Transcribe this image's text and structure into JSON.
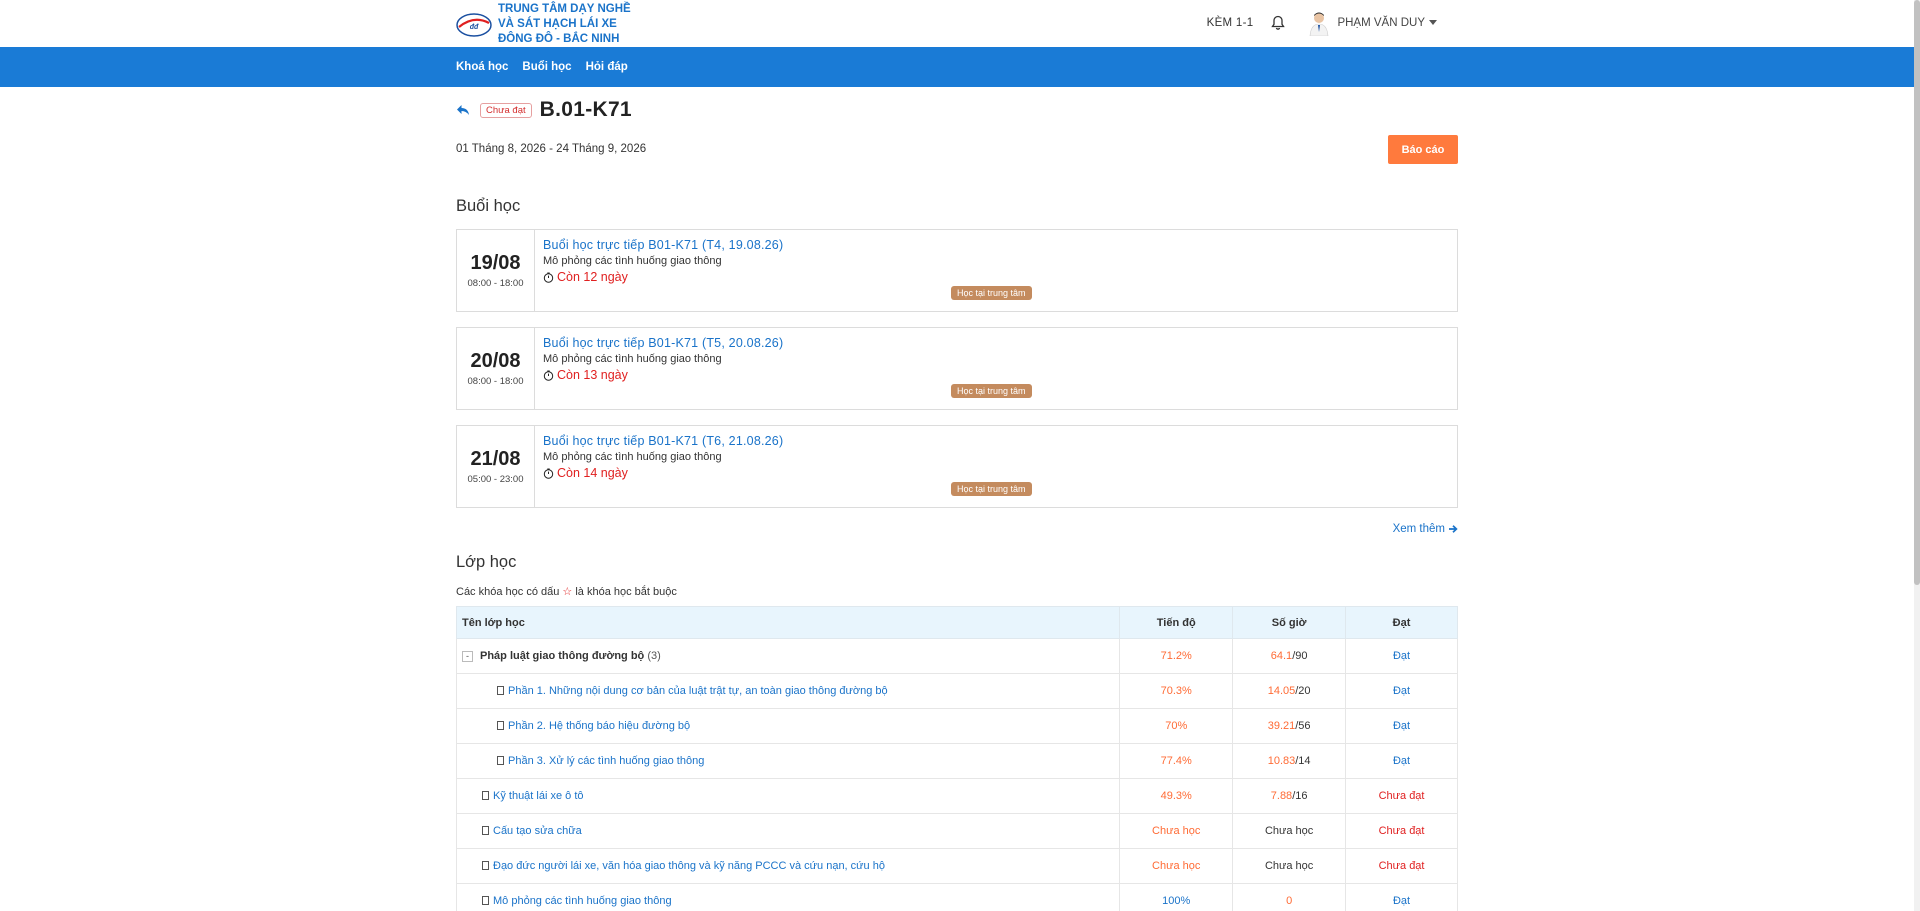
{
  "brand": {
    "name": "TRUNG TÂM DẠY NGHỀ VÀ SÁT HẠCH LÁI XE ĐÔNG ĐÔ - BẮC NINH",
    "logo_icon": "dong-do-logo"
  },
  "topbar": {
    "kem_label": "KÈM 1-1",
    "user_name": "PHẠM VĂN DUY"
  },
  "nav": {
    "items": [
      "Khoá học",
      "Buổi học",
      "Hỏi đáp"
    ]
  },
  "course": {
    "status": "Chưa đạt",
    "code": "B.01-K71",
    "date_range": "01 Tháng 8, 2026 - 24 Tháng 9, 2026",
    "report_label": "Báo cáo"
  },
  "sessions_section": {
    "title": "Buổi học",
    "items": [
      {
        "day": "19/08",
        "time": "08:00 - 18:00",
        "title": "Buổi học trực tiếp B01-K71 (T4, 19.08.26)",
        "subtitle": "Mô phỏng các tình huống giao thông",
        "remaining": "Còn 12 ngày",
        "tag": "Học tại trung tâm"
      },
      {
        "day": "20/08",
        "time": "08:00 - 18:00",
        "title": "Buổi học trực tiếp B01-K71 (T5, 20.08.26)",
        "subtitle": "Mô phỏng các tình huống giao thông",
        "remaining": "Còn 13 ngày",
        "tag": "Học tại trung tâm"
      },
      {
        "day": "21/08",
        "time": "05:00 - 23:00",
        "title": "Buổi học trực tiếp B01-K71 (T6, 21.08.26)",
        "subtitle": "Mô phỏng các tình huống giao thông",
        "remaining": "Còn 14 ngày",
        "tag": "Học tại trung tâm"
      }
    ],
    "see_more": "Xem thêm"
  },
  "classes_section": {
    "title": "Lớp học",
    "note_before": "Các khóa học có dấu",
    "note_star": "☆",
    "note_after": "là khóa học bắt buộc",
    "headers": {
      "name": "Tên lớp học",
      "progress": "Tiến độ",
      "hours": "Số giờ",
      "pass": "Đạt"
    },
    "group": {
      "toggle": "-",
      "name": "Pháp luật giao thông đường bộ",
      "count": "(3)",
      "progress": "71.2%",
      "hours_done": "64.1",
      "hours_total": "/90",
      "pass": "Đạt"
    },
    "rows": [
      {
        "name": "Phần 1. Những nội dung cơ bản của luật trật tự, an toàn giao thông đường bộ",
        "progress": "70.3%",
        "hours_done": "14.05",
        "hours_total": "/20",
        "pass": "Đạt"
      },
      {
        "name": "Phần 2. Hệ thống báo hiệu đường bộ",
        "progress": "70%",
        "hours_done": "39.21",
        "hours_total": "/56",
        "pass": "Đạt"
      },
      {
        "name": "Phần 3. Xử lý các tình huống giao thông",
        "progress": "77.4%",
        "hours_done": "10.83",
        "hours_total": "/14",
        "pass": "Đạt"
      },
      {
        "name": "Kỹ thuật lái xe ô tô",
        "progress": "49.3%",
        "hours_done": "7.88",
        "hours_total": "/16",
        "pass": "Chưa đạt"
      },
      {
        "name": "Cấu tạo sửa chữa",
        "progress": "Chưa học",
        "hours_done": "",
        "hours_total": "Chưa học",
        "pass": "Chưa đạt"
      },
      {
        "name": "Đạo đức người lái xe, văn hóa giao thông và kỹ năng PCCC và cứu nạn, cứu hộ",
        "progress": "Chưa học",
        "hours_done": "",
        "hours_total": "Chưa học",
        "pass": "Chưa đạt"
      },
      {
        "name": "Mô phỏng các tình huống giao thông",
        "progress": "100%",
        "hours_done": "0",
        "hours_total": "",
        "pass": "Đạt"
      }
    ]
  },
  "colors": {
    "accent_blue": "#1a7bd6",
    "orange": "#ff7a3d",
    "red": "#e02020",
    "tag_brown": "#c48b5e"
  }
}
